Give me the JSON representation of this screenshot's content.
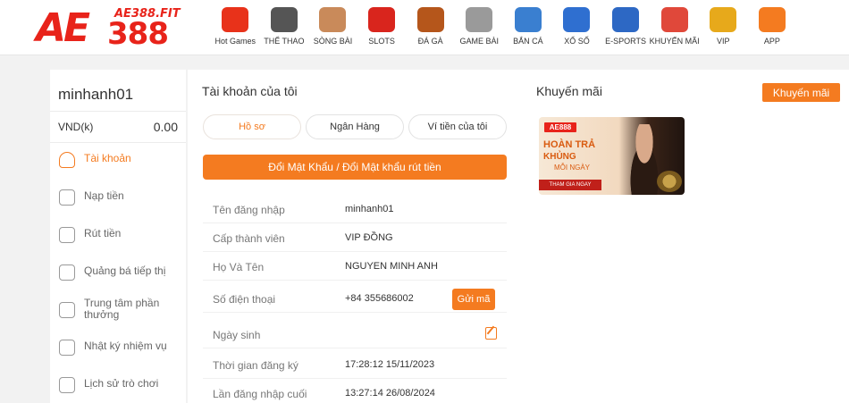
{
  "header": {
    "logo": {
      "text": "AE",
      "number": "388",
      "domain": "AE388.FIT"
    },
    "nav": [
      {
        "label": "Hot Games",
        "icon": "flame-icon",
        "color": "#e8321a"
      },
      {
        "label": "THỂ THAO",
        "icon": "soccer-ball-icon",
        "color": "#555555"
      },
      {
        "label": "SÒNG BÀI",
        "icon": "casino-dealer-icon",
        "color": "#c98a5a"
      },
      {
        "label": "SLOTS",
        "icon": "slot-machine-icon",
        "color": "#d9251d"
      },
      {
        "label": "ĐÁ GÀ",
        "icon": "rooster-icon",
        "color": "#b5561b"
      },
      {
        "label": "GAME BÀI",
        "icon": "dice-icon",
        "color": "#9a9a9a"
      },
      {
        "label": "BẮN CÁ",
        "icon": "fish-icon",
        "color": "#3a7fd0"
      },
      {
        "label": "XỔ SỐ",
        "icon": "lottery-ball-icon",
        "color": "#2f6fd0"
      },
      {
        "label": "E-SPORTS",
        "icon": "gamepad-icon",
        "color": "#2d68c4"
      },
      {
        "label": "KHUYẾN MÃI",
        "icon": "gift-icon",
        "color": "#e0483a"
      },
      {
        "label": "VIP",
        "icon": "crown-icon",
        "color": "#e7a91b"
      },
      {
        "label": "APP",
        "icon": "download-icon",
        "color": "#f47b20"
      }
    ]
  },
  "sidebar": {
    "username": "minhanh01",
    "currency": "VND(k)",
    "balance": "0.00",
    "items": [
      {
        "label": "Tài khoản",
        "icon": "user-shield-icon",
        "active": true
      },
      {
        "label": "Nạp tiền",
        "icon": "deposit-hand-icon"
      },
      {
        "label": "Rút tiền",
        "icon": "withdraw-hand-icon"
      },
      {
        "label": "Quảng bá tiếp thị",
        "icon": "promotion-hand-icon"
      },
      {
        "label": "Trung tâm phần thưởng",
        "icon": "reward-gift-icon"
      },
      {
        "label": "Nhật ký nhiệm vụ",
        "icon": "task-list-icon"
      },
      {
        "label": "Lịch sử trò chơi",
        "icon": "game-history-icon"
      }
    ]
  },
  "account": {
    "title": "Tài khoản của tôi",
    "tabs": [
      {
        "label": "Hồ sơ",
        "active": true
      },
      {
        "label": "Ngân Hàng"
      },
      {
        "label": "Ví tiền của tôi"
      }
    ],
    "change_password_label": "Đổi Mật Khẩu / Đổi Mật khẩu rút tiền",
    "rows": [
      {
        "label": "Tên đăng nhập",
        "value": "minhanh01"
      },
      {
        "label": "Cấp thành viên",
        "value": "VIP ĐỒNG"
      },
      {
        "label": "Họ Và Tên",
        "value": "NGUYEN MINH ANH"
      },
      {
        "label": "Số điện thoại",
        "value": "+84 355686002"
      },
      {
        "label": "Ngày sinh",
        "value": ""
      },
      {
        "label": "Thời gian đăng ký",
        "value": "17:28:12 15/11/2023"
      },
      {
        "label": "Lần đăng nhập cuối",
        "value": "13:27:14 26/08/2024"
      }
    ],
    "send_code_label": "Gửi mã"
  },
  "promo": {
    "title": "Khuyến mãi",
    "button_label": "Khuyến mãi",
    "banner": {
      "logo": "AE888",
      "line1": "HOÀN TRẢ",
      "line2": "KHỦNG",
      "line3": "MỖI NGÀY",
      "cta": "THAM GIA NGAY"
    }
  },
  "colors": {
    "accent": "#f47b20",
    "brand_red": "#e8231a"
  }
}
